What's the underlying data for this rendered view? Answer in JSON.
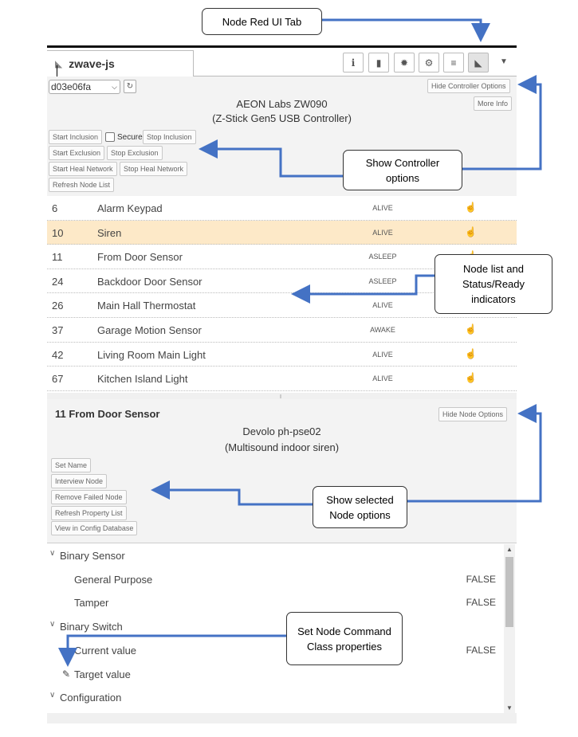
{
  "callouts": {
    "ui_tab": "Node Red UI Tab",
    "controller": [
      "Show Controller",
      "options"
    ],
    "nodelist": [
      "Node list and",
      "Status/Ready",
      "indicators"
    ],
    "node_opts": [
      "Show selected",
      "Node options"
    ],
    "cc_props": [
      "Set Node Command",
      "Class properties"
    ]
  },
  "colors": {
    "arrow": "#4472c4",
    "selected_row": "#fde9c8",
    "panel_bg": "#f3f3f3"
  },
  "tab": {
    "icon": "rss-icon",
    "label": "zwave-js"
  },
  "toolbar": {
    "icons": [
      "info-icon",
      "book-icon",
      "bug-icon",
      "gear-icon",
      "database-icon",
      "rss-icon",
      "chevron-down-icon"
    ]
  },
  "controller": {
    "selected_id": "d03e06fa",
    "name_line1": "AEON Labs ZW090",
    "name_line2": "(Z-Stick Gen5 USB Controller)",
    "hide_options": "Hide Controller Options",
    "more_info": "More Info",
    "start_inclusion": "Start Inclusion",
    "secure": "Secure",
    "stop_inclusion": "Stop Inclusion",
    "start_exclusion": "Start Exclusion",
    "stop_exclusion": "Stop Exclusion",
    "start_heal": "Start Heal Network",
    "stop_heal": "Stop Heal Network",
    "refresh_list": "Refresh Node List"
  },
  "nodes": [
    {
      "id": "6",
      "name": "Alarm Keypad",
      "status": "ALIVE",
      "ready": true
    },
    {
      "id": "10",
      "name": "Siren",
      "status": "ALIVE",
      "ready": true,
      "selected": true
    },
    {
      "id": "11",
      "name": "From Door Sensor",
      "status": "ASLEEP",
      "ready": true
    },
    {
      "id": "24",
      "name": "Backdoor Door Sensor",
      "status": "ASLEEP",
      "ready": true
    },
    {
      "id": "26",
      "name": "Main Hall Thermostat",
      "status": "ALIVE",
      "ready": true
    },
    {
      "id": "37",
      "name": "Garage Motion Sensor",
      "status": "AWAKE",
      "ready": true
    },
    {
      "id": "42",
      "name": "Living Room Main Light",
      "status": "ALIVE",
      "ready": true
    },
    {
      "id": "67",
      "name": "Kitchen Island Light",
      "status": "ALIVE",
      "ready": true
    }
  ],
  "node": {
    "title": "11 From Door Sensor",
    "hide_options": "Hide Node Options",
    "product": "Devolo ph-pse02",
    "description": "(Multisound indoor siren)",
    "set_name": "Set Name",
    "interview": "Interview Node",
    "remove_failed": "Remove Failed Node",
    "refresh_props": "Refresh Property List",
    "view_config": "View in Config Database"
  },
  "properties": {
    "binary_sensor": "Binary Sensor",
    "general_purpose": "General Purpose",
    "general_purpose_val": "FALSE",
    "tamper": "Tamper",
    "tamper_val": "FALSE",
    "binary_switch": "Binary Switch",
    "current_value": "Current value",
    "current_value_val": "FALSE",
    "target_value": "Target value",
    "configuration": "Configuration"
  }
}
